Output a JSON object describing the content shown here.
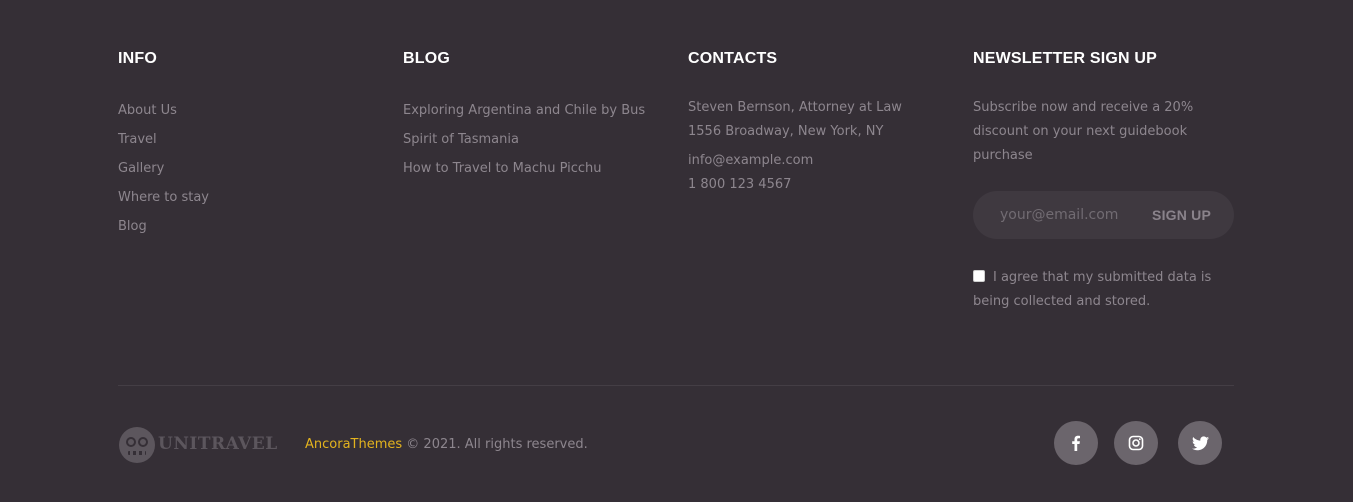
{
  "info": {
    "heading": "INFO",
    "links": [
      "About Us",
      "Travel",
      "Gallery",
      "Where to stay",
      "Blog"
    ]
  },
  "blog": {
    "heading": "BLOG",
    "links": [
      "Exploring Argentina and Chile by Bus",
      "Spirit of Tasmania",
      "How to Travel to Machu Picchu"
    ]
  },
  "contacts": {
    "heading": "CONTACTS",
    "address": "Steven Bernson, Attorney at Law 1556 Broadway, New York, NY",
    "email": "info@example.com",
    "phone": "1 800 123 4567"
  },
  "newsletter": {
    "heading": "NEWSLETTER SIGN UP",
    "description": "Subscribe now and receive a 20% discount on your next guidebook purchase",
    "email_placeholder": "your@email.com",
    "submit_label": "SIGN UP",
    "consent_text": "I agree that my submitted data is being collected and stored."
  },
  "footer": {
    "logo_text": "UniTravel",
    "brand_link": "AncoraThemes",
    "copyright": " © 2021. All rights reserved.",
    "social": [
      {
        "icon": "facebook-icon"
      },
      {
        "icon": "instagram-icon"
      },
      {
        "icon": "twitter-icon"
      }
    ]
  },
  "colors": {
    "background": "#352f36",
    "heading": "#ffffff",
    "text": "#8d868e",
    "accent": "#e3b31e",
    "social_button": "#6b656c"
  }
}
